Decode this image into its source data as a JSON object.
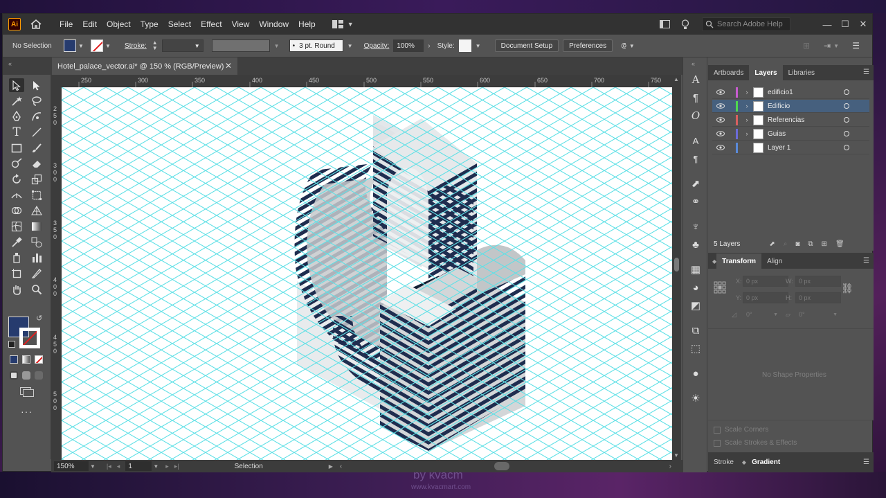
{
  "app": {
    "logo": "Ai",
    "accent_color": "#ff9a00",
    "document_tab": "Hotel_palace_vector.ai* @ 150 % (RGB/Preview)"
  },
  "menu": [
    "File",
    "Edit",
    "Object",
    "Type",
    "Select",
    "Effect",
    "View",
    "Window",
    "Help"
  ],
  "search": {
    "placeholder": "Search Adobe Help"
  },
  "control_bar": {
    "selection_state": "No Selection",
    "stroke_label": "Stroke:",
    "brush_label": "3 pt. Round",
    "opacity_label": "Opacity:",
    "opacity_value": "100%",
    "style_label": "Style:",
    "document_setup": "Document Setup",
    "preferences": "Preferences",
    "fill_color": "#263b6e"
  },
  "ruler": {
    "horizontal": [
      "250",
      "300",
      "350",
      "400",
      "450",
      "500",
      "550",
      "600",
      "650",
      "700",
      "750"
    ],
    "vertical": [
      [
        "2",
        "5",
        "0"
      ],
      [
        "3",
        "0",
        "0"
      ],
      [
        "3",
        "5",
        "0"
      ],
      [
        "4",
        "0",
        "0"
      ],
      [
        "4",
        "5",
        "0"
      ],
      [
        "5",
        "0",
        "0"
      ]
    ]
  },
  "status_bar": {
    "zoom": "150%",
    "artboard": "1",
    "tool": "Selection"
  },
  "layers_panel": {
    "tabs": [
      "Artboards",
      "Layers",
      "Libraries"
    ],
    "active_tab": "Layers",
    "layers": [
      {
        "name": "edificio1",
        "color": "#c85cd0",
        "selected": false,
        "expandable": true
      },
      {
        "name": "Edificio",
        "color": "#4fd94f",
        "selected": true,
        "expandable": true
      },
      {
        "name": "Referencias",
        "color": "#d96060",
        "selected": false,
        "expandable": true
      },
      {
        "name": "Guias",
        "color": "#6c6cd9",
        "selected": false,
        "expandable": true
      },
      {
        "name": "Layer 1",
        "color": "#5a8ad9",
        "selected": false,
        "expandable": false
      }
    ],
    "count": "5 Layers"
  },
  "transform_panel": {
    "tabs": [
      "Transform",
      "Align"
    ],
    "active_tab": "Transform",
    "x_label": "X:",
    "x_value": "0 px",
    "y_label": "Y:",
    "y_value": "0 px",
    "w_label": "W:",
    "w_value": "0 px",
    "h_label": "H:",
    "h_value": "0 px",
    "rotate_value": "0°",
    "shear_value": "0°",
    "empty_message": "No Shape Properties",
    "scale_corners": "Scale Corners",
    "scale_strokes": "Scale Strokes & Effects"
  },
  "bottom_panel": {
    "tabs": [
      "Stroke",
      "Gradient"
    ],
    "active_tab": "Gradient"
  },
  "watermark": {
    "line1": "by kvacm",
    "line2": "www.kvacmart.com"
  },
  "artwork": {
    "grid_color": "#5fe0e6",
    "dark_stroke": "#1f2d4f",
    "light_fill": "#e3e7ea",
    "mid_fill": "#c0c4c6"
  }
}
